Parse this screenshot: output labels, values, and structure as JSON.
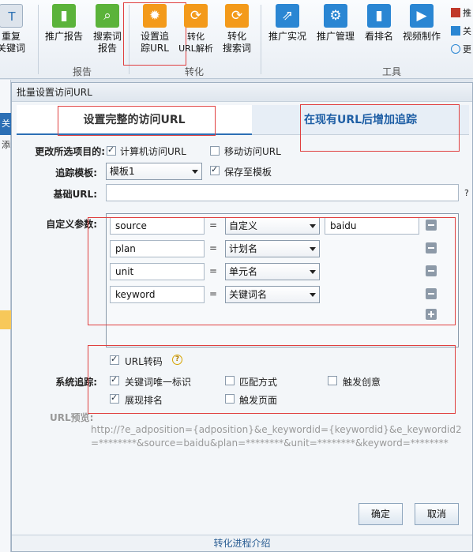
{
  "ribbon": {
    "buttons": [
      {
        "label": "重复\n关键词",
        "icon": "duplicate-keyword-icon",
        "glyph": "T"
      },
      {
        "label": "推广报告",
        "icon": "bar-chart-icon",
        "glyph": "▮"
      },
      {
        "label": "搜索词\n报告",
        "icon": "search-report-icon",
        "glyph": "⌕"
      },
      {
        "label": "设置追\n踪URL",
        "icon": "gear-icon",
        "glyph": "✹"
      },
      {
        "label": "转化\nURL解析",
        "icon": "refresh-icon",
        "glyph": "⟳"
      },
      {
        "label": "转化\n搜索词",
        "icon": "convert-search-icon",
        "glyph": "⟳"
      },
      {
        "label": "推广实况",
        "icon": "share-icon",
        "glyph": "⇗"
      },
      {
        "label": "推广管理",
        "icon": "manage-icon",
        "glyph": "⚙"
      },
      {
        "label": "看排名",
        "icon": "ranking-icon",
        "glyph": "▮"
      },
      {
        "label": "视频制作",
        "icon": "video-icon",
        "glyph": "▶"
      }
    ],
    "groups": {
      "report": "报告",
      "convert": "转化",
      "tools": "工具"
    },
    "mini": [
      {
        "label": "推",
        "icon": "mini-chart-icon"
      },
      {
        "label": "关",
        "icon": "mini-text-icon"
      },
      {
        "label": "更",
        "icon": "mini-plus-icon"
      }
    ]
  },
  "background_app": {
    "tab": "关",
    "item": "添"
  },
  "dialog": {
    "title": "批量设置访问URL",
    "tabs": [
      "设置完整的访问URL",
      "在现有URL后增加追踪"
    ],
    "change_items_label": "更改所选项目的:",
    "pc_url": {
      "label": "计算机访问URL",
      "checked": true
    },
    "mobile_url": {
      "label": "移动访问URL",
      "checked": false
    },
    "template_label": "追踪模板:",
    "template_value": "模板1",
    "save_template": {
      "label": "保存至模板",
      "checked": true
    },
    "base_url_label": "基础URL:",
    "base_url_value": "",
    "base_url_help": "?",
    "custom_params_label": "自定义参数:",
    "params": [
      {
        "name": "source",
        "eq": "=",
        "type": "自定义",
        "value": "baidu"
      },
      {
        "name": "plan",
        "eq": "=",
        "type": "计划名",
        "value": ""
      },
      {
        "name": "unit",
        "eq": "=",
        "type": "单元名",
        "value": ""
      },
      {
        "name": "keyword",
        "eq": "=",
        "type": "关键词名",
        "value": ""
      }
    ],
    "url_encode": {
      "label": "URL转码",
      "checked": true,
      "help": "?"
    },
    "system_tracking_label": "系统追踪:",
    "tracking": [
      {
        "label": "关键词唯一标识",
        "checked": true
      },
      {
        "label": "匹配方式",
        "checked": false
      },
      {
        "label": "触发创意",
        "checked": false
      },
      {
        "label": "展现排名",
        "checked": true
      },
      {
        "label": "触发页面",
        "checked": false
      }
    ],
    "preview_label": "URL预览:",
    "preview_text": "http://?e_adposition={adposition}&e_keywordid={keywordid}&e_keywordid2=********&source=baidu&plan=********&unit=********&keyword=********",
    "ok": "确定",
    "cancel": "取消",
    "footer": "转化进程介绍"
  },
  "colors": {
    "accent": "#2c6fb5",
    "highlight": "#e04040",
    "tab_text": "#1f5fa5"
  }
}
